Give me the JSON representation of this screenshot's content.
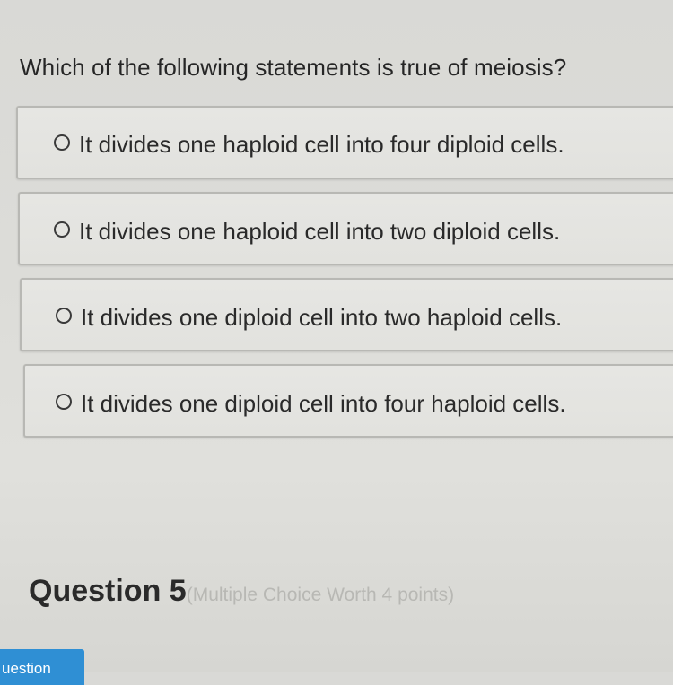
{
  "question": {
    "text": "Which of the following statements is true of meiosis?"
  },
  "options": [
    {
      "label": "It divides one haploid cell into four diploid cells."
    },
    {
      "label": "It divides one haploid cell into two diploid cells."
    },
    {
      "label": "It divides one diploid cell into two haploid cells."
    },
    {
      "label": "It divides one diploid cell into four haploid cells."
    }
  ],
  "next_question": {
    "title": "Question 5",
    "meta": "(Multiple Choice Worth 4 points)"
  },
  "bottom_button": {
    "label": "uestion"
  },
  "colors": {
    "button_blue": "#2f8fd4",
    "background": "#dcdcd8"
  }
}
